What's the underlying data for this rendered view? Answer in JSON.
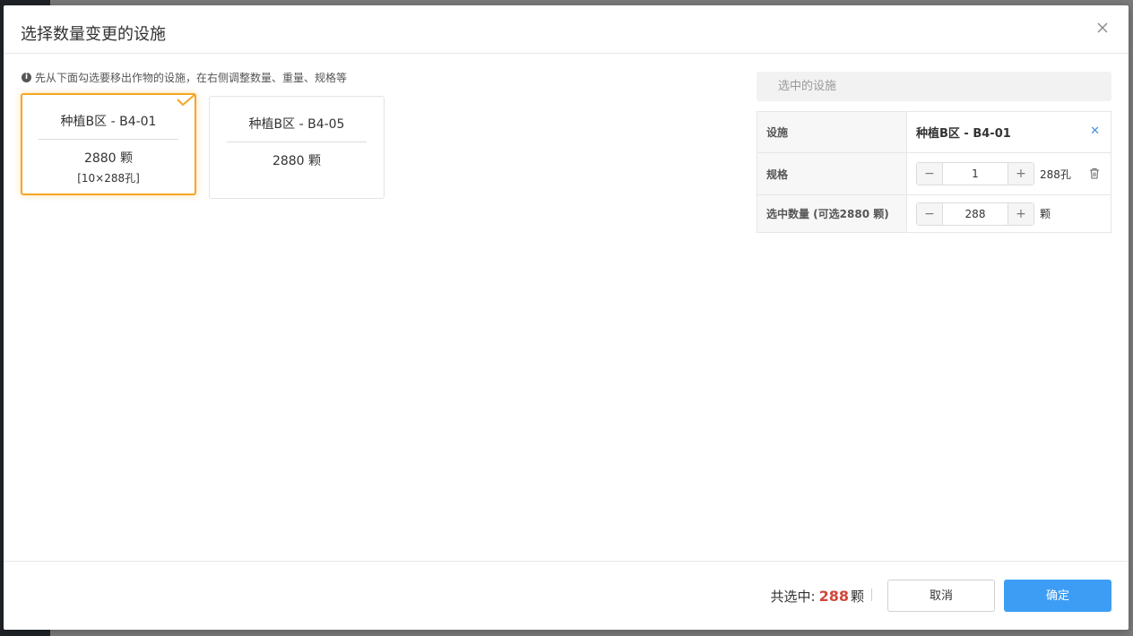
{
  "modal": {
    "title": "选择数量变更的设施",
    "hint": "先从下面勾选要移出作物的设施，在右侧调整数量、重量、规格等"
  },
  "cards": [
    {
      "name": "种植B区 - B4-01",
      "count": "2880 颗",
      "spec": "[10×288孔]",
      "selected": true
    },
    {
      "name": "种植B区 - B4-05",
      "count": "2880 颗",
      "selected": false
    }
  ],
  "panel": {
    "title": "选中的设施",
    "rows": {
      "facility_label": "设施",
      "facility_value": "种植B区 - B4-01",
      "spec_label": "规格",
      "spec_value": "1",
      "spec_unit": "288孔",
      "qty_label": "选中数量 (可选2880 颗)",
      "qty_value": "288",
      "qty_unit": "颗"
    }
  },
  "footer": {
    "total_prefix": "共选中:",
    "total_value": "288",
    "total_unit": "颗",
    "cancel_label": "取消",
    "ok_label": "确定"
  },
  "colors": {
    "accent": "#3d9df5",
    "selected": "#f5a623",
    "total": "#d0473b"
  },
  "icons": [
    "close-icon",
    "info-icon",
    "check-icon",
    "remove-icon",
    "trash-icon",
    "minus-icon",
    "plus-icon"
  ]
}
